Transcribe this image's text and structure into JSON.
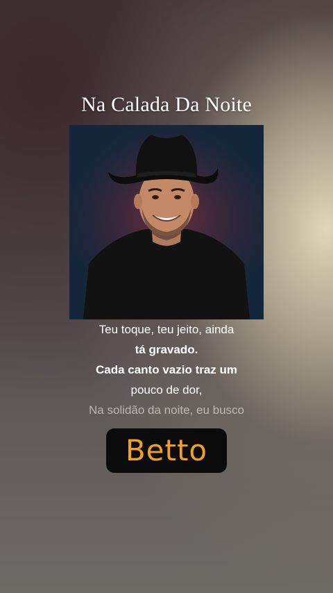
{
  "song": {
    "title": "Na Calada Da Noite"
  },
  "lyrics": {
    "lines": [
      "Teu toque, teu jeito, ainda",
      "tá gravado.",
      "Cada canto vazio traz um",
      "pouco de dor,",
      "Na solidão da noite, eu busco"
    ],
    "active_lines": [
      1,
      2
    ]
  },
  "artist": {
    "name": "Betto",
    "accent_color": "#f0a11e"
  },
  "cover": {
    "description_icon": "cover-art-image"
  }
}
